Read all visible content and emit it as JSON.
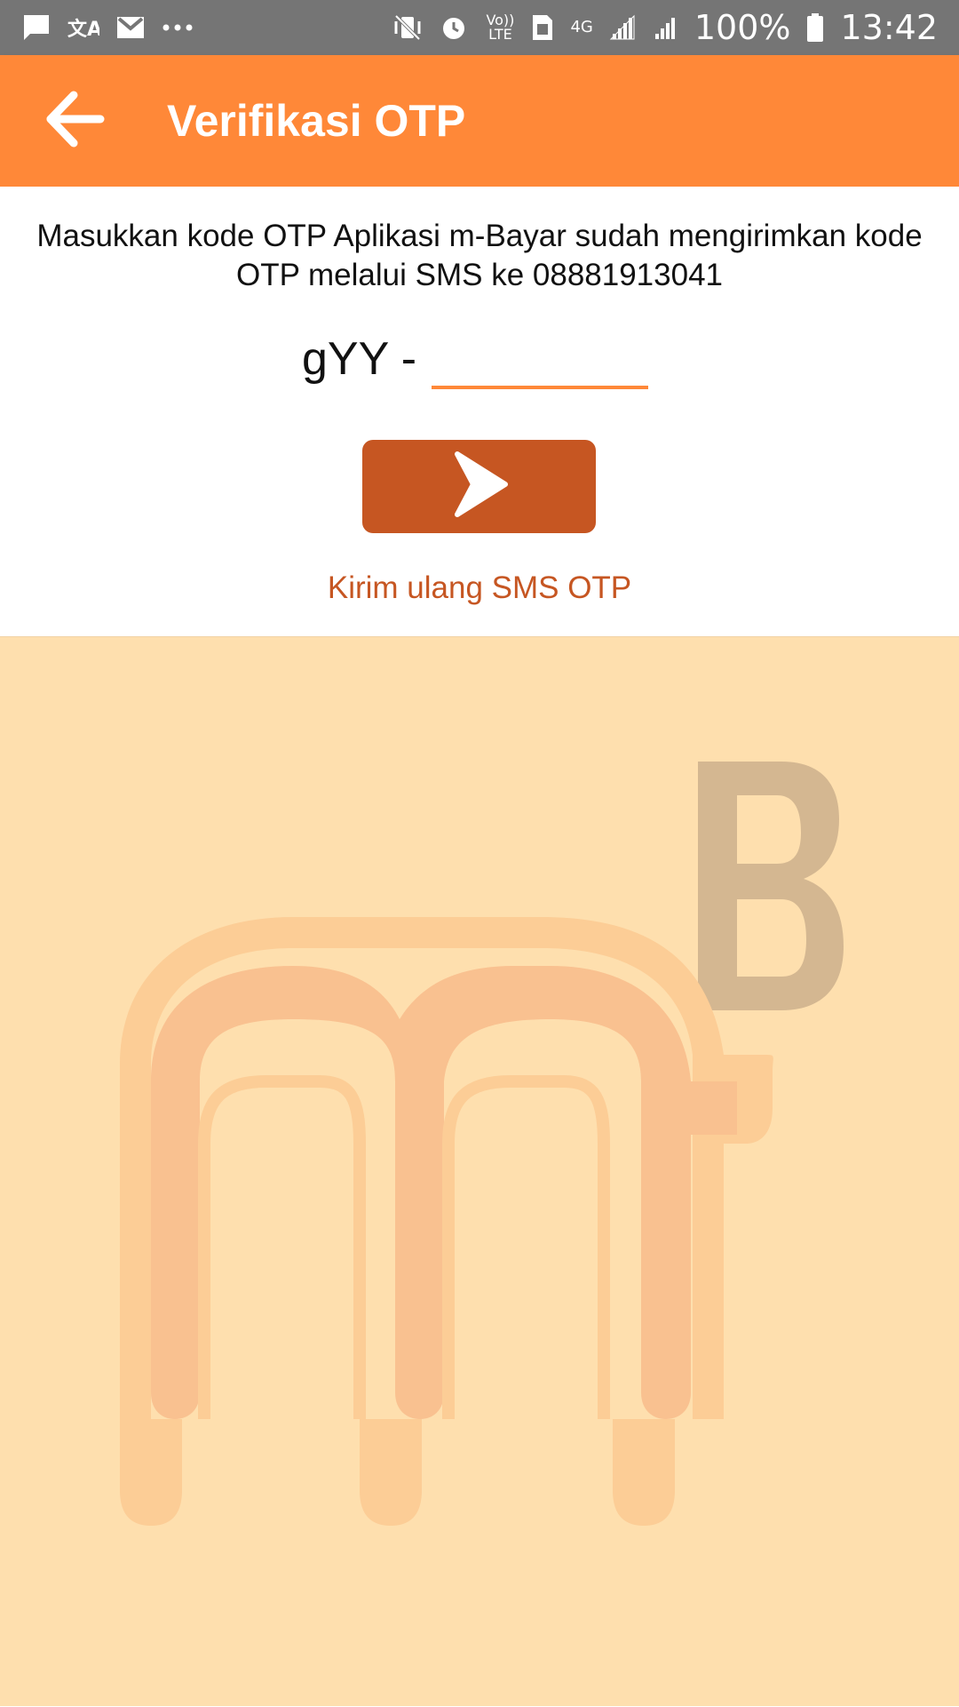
{
  "status_bar": {
    "left_icons": [
      "message-icon",
      "translate-icon",
      "gmail-icon",
      "more-dots-icon"
    ],
    "right_icons": [
      "vibrate-icon",
      "alarm-icon",
      "volte-icon",
      "sim-icon",
      "network-4g-icon",
      "signal-icon",
      "signal-icon-2",
      "battery-icon"
    ],
    "volte_label": "Vo)) LTE",
    "network_label": "4G",
    "battery": "100%",
    "time": "13:42"
  },
  "app_bar": {
    "title": "Verifikasi OTP",
    "back_icon": "arrow-left-icon",
    "color": "#ff8838"
  },
  "otp": {
    "instruction": "Masukkan kode OTP Aplikasi m-Bayar sudah mengirimkan kode OTP melalui SMS ke 08881913041",
    "prefix": "gYY -",
    "input_value": "",
    "submit_icon": "chevron-right-icon",
    "resend_label": "Kirim ulang SMS OTP"
  },
  "colors": {
    "accent": "#ff8838",
    "button": "#c65622",
    "background_bottom": "#fedfae"
  },
  "watermark": {
    "logo": "m-bayar-logo",
    "letters": "mB"
  }
}
